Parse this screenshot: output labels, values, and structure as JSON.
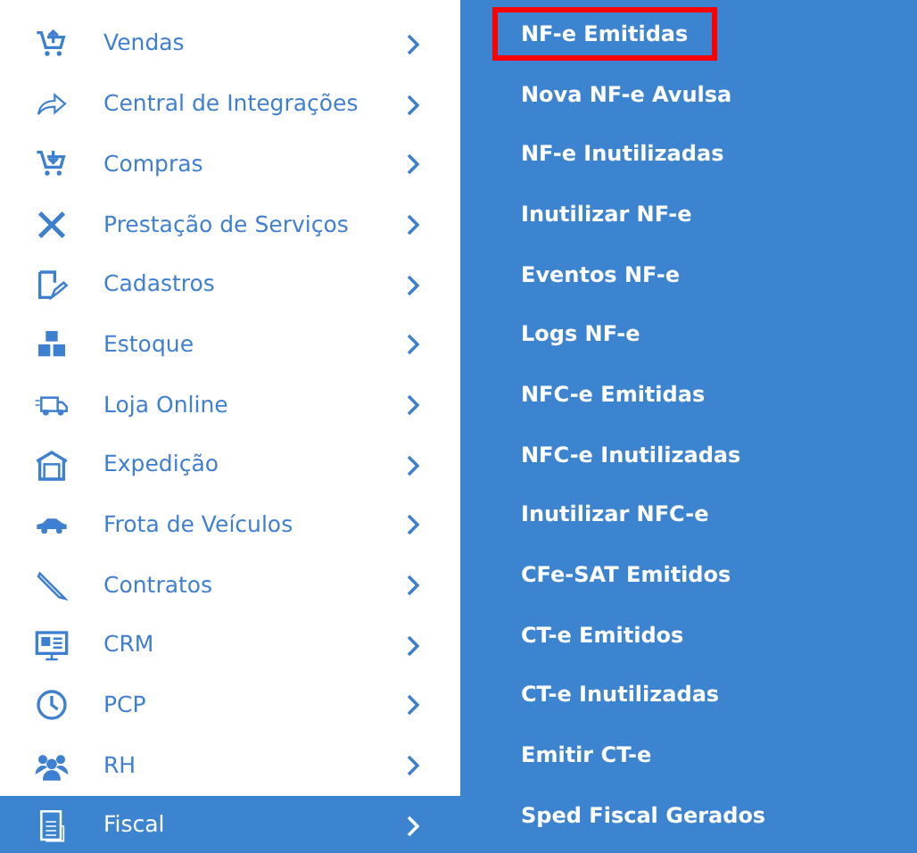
{
  "menu": {
    "items": [
      {
        "label": "Vendas",
        "selected": false
      },
      {
        "label": "Central de Integrações",
        "selected": false
      },
      {
        "label": "Compras",
        "selected": false
      },
      {
        "label": "Prestação de Serviços",
        "selected": false
      },
      {
        "label": "Cadastros",
        "selected": false
      },
      {
        "label": "Estoque",
        "selected": false
      },
      {
        "label": "Loja Online",
        "selected": false
      },
      {
        "label": "Expedição",
        "selected": false
      },
      {
        "label": "Frota de Veículos",
        "selected": false
      },
      {
        "label": "Contratos",
        "selected": false
      },
      {
        "label": "CRM",
        "selected": false
      },
      {
        "label": "PCP",
        "selected": false
      },
      {
        "label": "RH",
        "selected": false
      },
      {
        "label": "Fiscal",
        "selected": true
      }
    ]
  },
  "submenu": {
    "items": [
      {
        "label": "NF-e Emitidas",
        "selected": true
      },
      {
        "label": "Nova NF-e Avulsa",
        "selected": false
      },
      {
        "label": "NF-e Inutilizadas",
        "selected": false
      },
      {
        "label": "Inutilizar NF-e",
        "selected": false
      },
      {
        "label": "Eventos NF-e",
        "selected": false
      },
      {
        "label": "Logs NF-e",
        "selected": false
      },
      {
        "label": "NFC-e Emitidas",
        "selected": false
      },
      {
        "label": "NFC-e Inutilizadas",
        "selected": false
      },
      {
        "label": "Inutilizar NFC-e",
        "selected": false
      },
      {
        "label": "CFe-SAT Emitidos",
        "selected": false
      },
      {
        "label": "CT-e Emitidos",
        "selected": false
      },
      {
        "label": "CT-e Inutilizadas",
        "selected": false
      },
      {
        "label": "Emitir CT-e",
        "selected": false
      },
      {
        "label": "Sped Fiscal Gerados",
        "selected": false
      }
    ]
  }
}
